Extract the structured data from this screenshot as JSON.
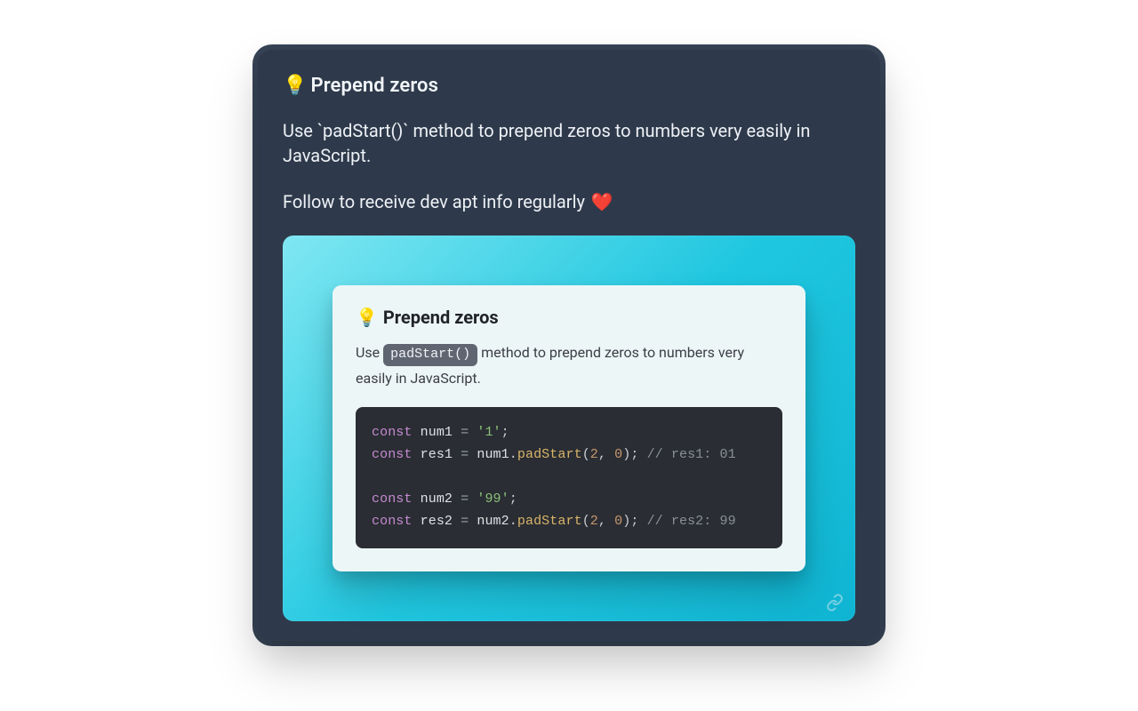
{
  "post": {
    "title_emoji": "💡",
    "title_text": "Prepend zeros",
    "body_line1_pre": "Use `",
    "body_line1_code": "padStart()",
    "body_line1_post": "` method to prepend zeros to numbers very easily in JavaScript.",
    "body_line2": "Follow to receive dev apt info regularly",
    "body_line2_emoji": "❤️"
  },
  "inner": {
    "title_emoji": "💡",
    "title_text": "Prepend zeros",
    "desc_pre": "Use ",
    "desc_code": "padStart()",
    "desc_post": " method to prepend zeros to numbers very easily in JavaScript."
  },
  "code": {
    "kw": "const",
    "eq": "=",
    "semi": ";",
    "dot": ".",
    "lp": "(",
    "rp": ")",
    "comma": ",",
    "l1_var": "num1",
    "l1_val": "'1'",
    "l2_var": "res1",
    "l2_recv": "num1",
    "l2_fn": "padStart",
    "l2_arg1": "2",
    "l2_arg2": "0",
    "l2_comment": "// res1: 01",
    "l3_var": "num2",
    "l3_val": "'99'",
    "l4_var": "res2",
    "l4_recv": "num2",
    "l4_fn": "padStart",
    "l4_arg1": "2",
    "l4_arg2": "0",
    "l4_comment": "// res2: 99"
  }
}
